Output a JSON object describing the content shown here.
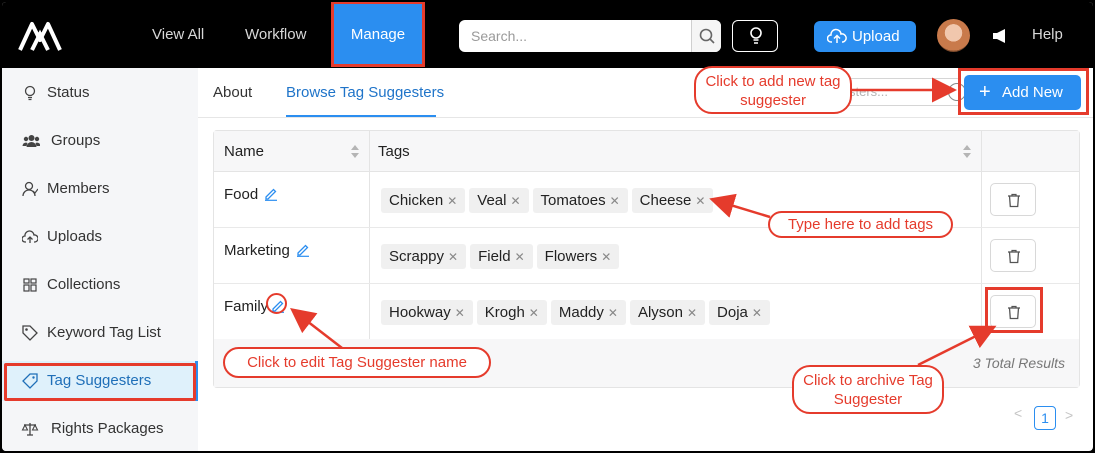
{
  "topnav": {
    "items": [
      "View All",
      "Workflow"
    ],
    "active": "Manage",
    "search_placeholder": "Search...",
    "upload_label": "Upload",
    "help_label": "Help"
  },
  "sidebar": {
    "items": [
      {
        "label": "Status",
        "icon": "bulb-icon"
      },
      {
        "label": "Groups",
        "icon": "users-icon"
      },
      {
        "label": "Members",
        "icon": "member-icon"
      },
      {
        "label": "Uploads",
        "icon": "cloud-upload-icon"
      },
      {
        "label": "Collections",
        "icon": "grid-icon"
      },
      {
        "label": "Keyword Tag List",
        "icon": "tag-list-icon"
      },
      {
        "label": "Tag Suggesters",
        "icon": "tag-icon"
      },
      {
        "label": "Rights Packages",
        "icon": "scales-icon"
      }
    ]
  },
  "tabs": [
    "About",
    "Browse Tag Suggesters"
  ],
  "mini_search_partial": "sters...",
  "add_new_label": "Add New",
  "table": {
    "headers": [
      "Name",
      "Tags"
    ],
    "rows": [
      {
        "name": "Food",
        "tags": [
          "Chicken",
          "Veal",
          "Tomatoes",
          "Cheese"
        ]
      },
      {
        "name": "Marketing",
        "tags": [
          "Scrappy",
          "Field",
          "Flowers"
        ]
      },
      {
        "name": "Family",
        "tags": [
          "Hookway",
          "Krogh",
          "Maddy",
          "Alyson",
          "Doja"
        ]
      }
    ],
    "total": "3 Total Results"
  },
  "pagination": {
    "current": "1",
    "prev": "<",
    "next": ">"
  },
  "annotations": {
    "add_new": "Click to add new tag suggester",
    "type_tags": "Type here to add tags",
    "edit_name": "Click to edit Tag Suggester name",
    "archive": "Click to archive Tag Suggester"
  },
  "colors": {
    "accent": "#2b8ef0",
    "annotation": "#e53b2c",
    "nav_bg": "#000000"
  }
}
